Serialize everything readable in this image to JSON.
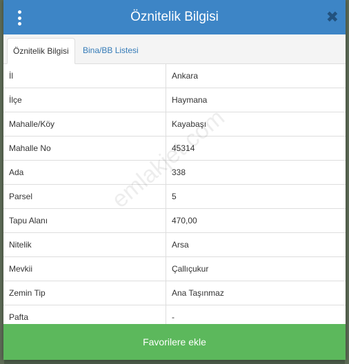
{
  "header": {
    "title": "Öznitelik Bilgisi"
  },
  "tabs": [
    {
      "label": "Öznitelik Bilgisi",
      "active": true
    },
    {
      "label": "Bina/BB Listesi",
      "active": false
    }
  ],
  "attributes": [
    {
      "label": "İl",
      "value": "Ankara"
    },
    {
      "label": "İlçe",
      "value": "Haymana"
    },
    {
      "label": "Mahalle/Köy",
      "value": "Kayabaşı"
    },
    {
      "label": "Mahalle No",
      "value": "45314"
    },
    {
      "label": "Ada",
      "value": "338"
    },
    {
      "label": "Parsel",
      "value": "5"
    },
    {
      "label": "Tapu Alanı",
      "value": "470,00"
    },
    {
      "label": "Nitelik",
      "value": "Arsa"
    },
    {
      "label": "Mevkii",
      "value": "Çallıçukur"
    },
    {
      "label": "Zemin Tip",
      "value": "Ana Taşınmaz"
    },
    {
      "label": "Pafta",
      "value": "-"
    }
  ],
  "footer": {
    "button_label": "Favorilere ekle"
  },
  "watermark": "emlakjet.com",
  "colors": {
    "header": "#3d85c6",
    "button": "#5cb85c",
    "link": "#337ab7"
  },
  "icons": {
    "menu": "vertical-dots-icon",
    "close": "close-icon"
  }
}
